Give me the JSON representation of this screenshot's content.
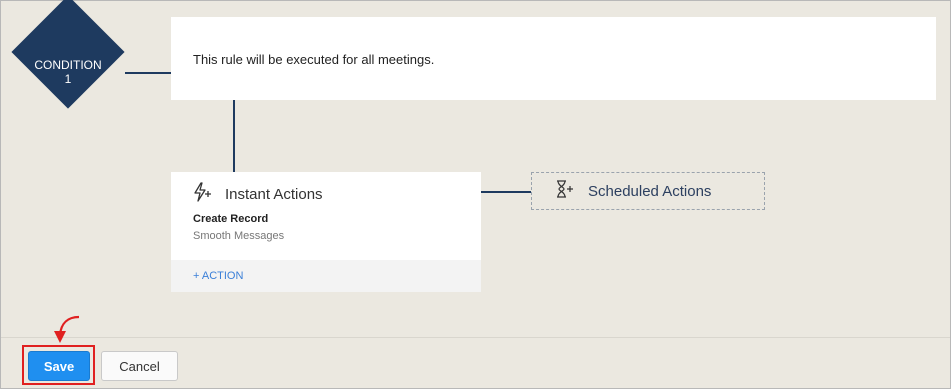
{
  "condition": {
    "label_line1": "CONDITION",
    "label_line2": "1",
    "text": "This rule will be executed for all meetings."
  },
  "instant_actions": {
    "title": "Instant Actions",
    "icon": "lightning-plus-icon",
    "action_title": "Create Record",
    "action_subtitle": "Smooth Messages",
    "add_action_label": "+ ACTION"
  },
  "scheduled_actions": {
    "title": "Scheduled Actions",
    "icon": "hourglass-plus-icon"
  },
  "footer": {
    "save_label": "Save",
    "cancel_label": "Cancel"
  },
  "colors": {
    "navy": "#1e3a5f",
    "save_blue": "#1f8ff0",
    "highlight_red": "#e02020",
    "link_blue": "#3a7fd8"
  }
}
